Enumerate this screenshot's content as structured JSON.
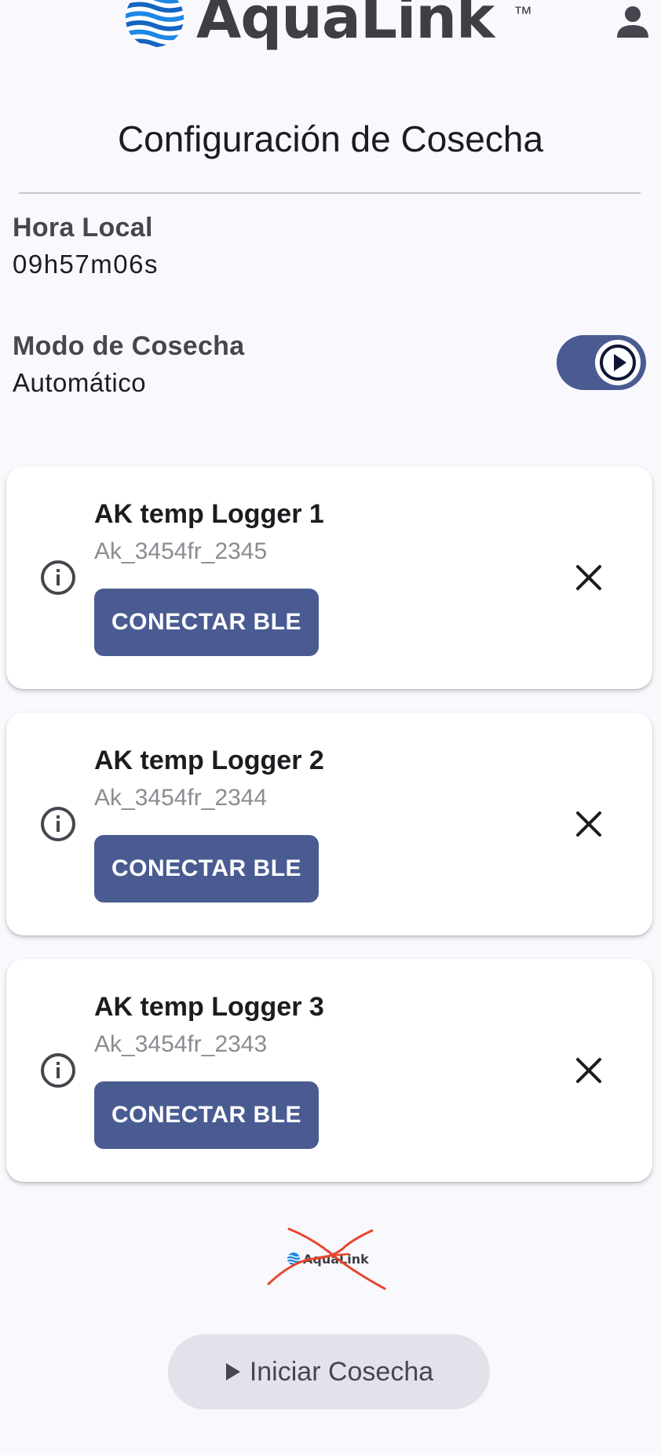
{
  "header": {
    "brand_name": "AquaLink",
    "brand_tm": "™"
  },
  "page": {
    "title": "Configuración de Cosecha"
  },
  "local_time": {
    "label": "Hora Local",
    "value": "09h57m06s"
  },
  "harvest_mode": {
    "label": "Modo de Cosecha",
    "value": "Automático",
    "toggle_on": true
  },
  "loggers": [
    {
      "name": "AK temp Logger 1",
      "id": "Ak_3454fr_2345",
      "button_label": "CONECTAR BLE"
    },
    {
      "name": "AK temp Logger 2",
      "id": "Ak_3454fr_2344",
      "button_label": "CONECTAR BLE"
    },
    {
      "name": "AK temp Logger 3",
      "id": "Ak_3454fr_2343",
      "button_label": "CONECTAR BLE"
    }
  ],
  "footer": {
    "small_logo_text": "AquaLink",
    "start_button_label": "Iniciar Cosecha"
  },
  "colors": {
    "primary": "#4a5b92",
    "background": "#f9f8fd",
    "logo_blue": "#1e88e5",
    "strike_red": "#e8452c",
    "secondary_button": "#e3e2ea"
  },
  "icons": {
    "profile": "person-icon",
    "info": "info-circle-icon",
    "close": "close-icon",
    "play": "play-icon",
    "logo": "wave-globe-icon"
  }
}
